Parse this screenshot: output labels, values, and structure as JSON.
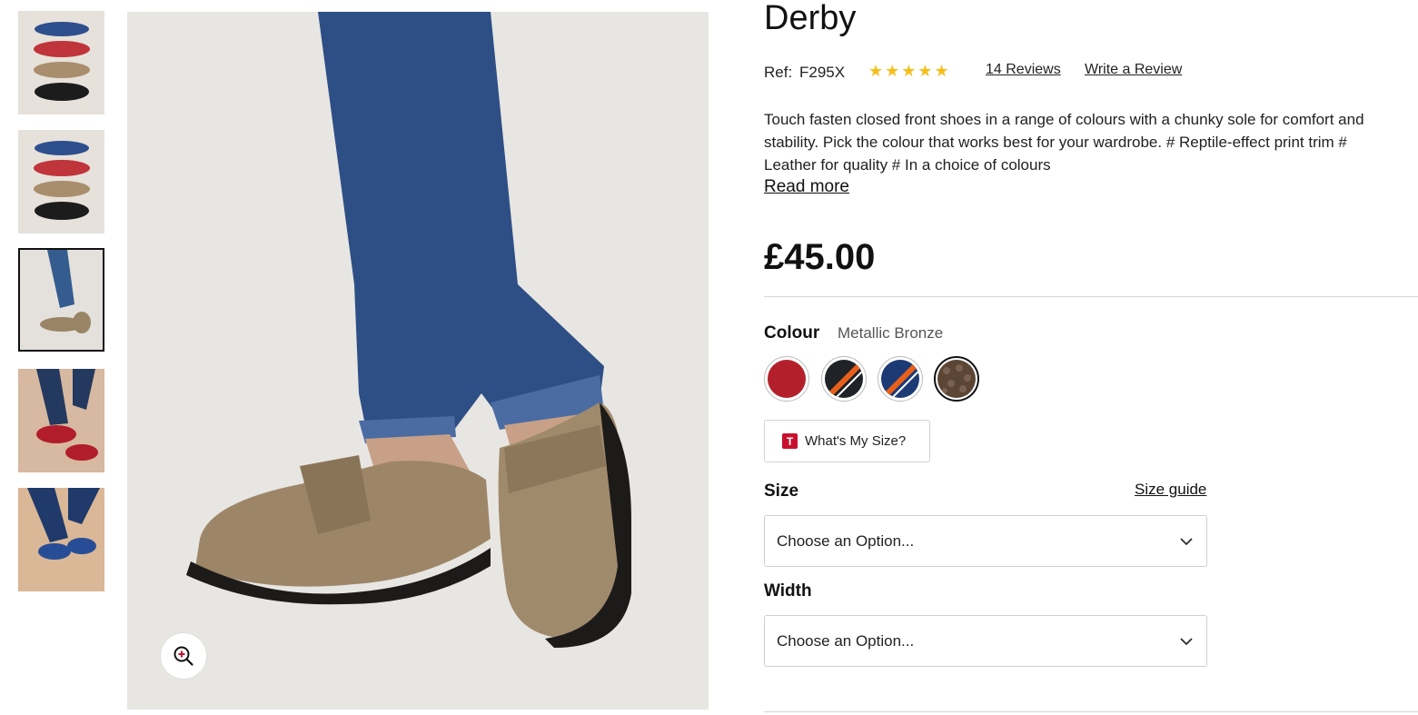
{
  "product": {
    "title": "Derby",
    "ref_label": "Ref:",
    "ref_code": "F295X",
    "rating_stars": "★★★★★",
    "rating": 5,
    "reviews_link": "14 Reviews",
    "write_review": "Write a Review",
    "description": "Touch fasten closed front shoes in a range of colours with a chunky sole for comfort and stability. Pick the colour that works best for your wardrobe. # Reptile-effect print trim # Leather for quality # In a choice of colours",
    "read_more": "Read more",
    "price": "£45.00"
  },
  "colour": {
    "label": "Colour",
    "selected": "Metallic Bronze",
    "swatches": [
      {
        "name": "red-swatch",
        "color": "#b3202b"
      },
      {
        "name": "black-orange-swatch",
        "color": "#1f2227",
        "stripe": "#e8601c"
      },
      {
        "name": "navy-orange-swatch",
        "color": "#1c3a74",
        "stripe": "#e8601c"
      },
      {
        "name": "bronze-swatch",
        "color": "#5b4636"
      }
    ]
  },
  "whats_my_size": {
    "icon_letter": "T",
    "label": "What's My Size?"
  },
  "size": {
    "label": "Size",
    "guide_link": "Size guide",
    "placeholder": "Choose an Option..."
  },
  "width": {
    "label": "Width",
    "placeholder": "Choose an Option..."
  },
  "gallery": {
    "thumbnails": [
      "four-colours-stack",
      "four-colours-stack-alt",
      "bronze-on-foot",
      "red-on-foot",
      "navy-on-foot"
    ],
    "active_index": 2
  },
  "colors": {
    "accent_star": "#f5bf1b",
    "brand_red": "#c8102e",
    "text": "#111111"
  }
}
